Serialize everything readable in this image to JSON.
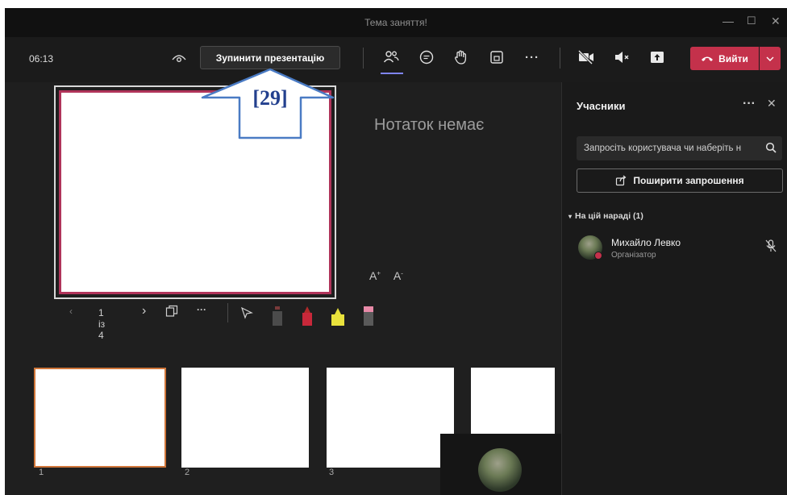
{
  "window": {
    "title": "Тема заняття!"
  },
  "toolbar": {
    "timer": "06:13",
    "stop_presentation": "Зупинити презентацію",
    "leave": "Вийти"
  },
  "stage": {
    "notes_placeholder": "Нотаток немає",
    "font_larger": "A",
    "font_smaller": "A",
    "slide_counter": "1 із 4",
    "thumbnails": [
      "1",
      "2",
      "3"
    ]
  },
  "annotation": {
    "label": "[29]"
  },
  "participants": {
    "title": "Учасники",
    "invite_placeholder": "Запросіть користувача чи наберіть н",
    "share_invite": "Поширити запрошення",
    "section": "На цій нараді (1)",
    "people": [
      {
        "name": "Михайло Левко",
        "role": "Організатор"
      }
    ]
  },
  "colors": {
    "leave_button": "#c4314b",
    "slide_border": "#b0345a",
    "annotation_arrow": "#23408e",
    "active_thumb": "#d0763a"
  }
}
